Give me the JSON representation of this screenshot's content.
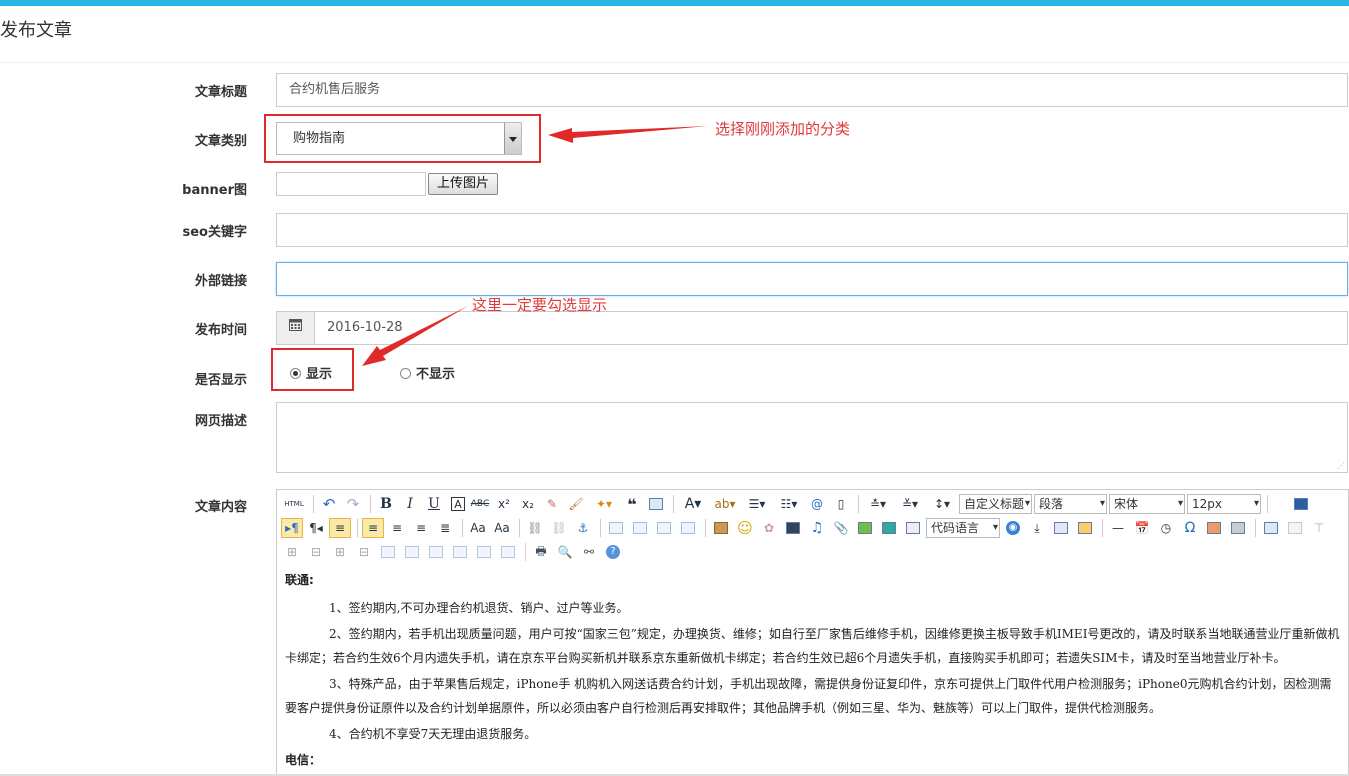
{
  "page": {
    "title": "发布文章"
  },
  "form": {
    "title_label": "文章标题",
    "title_value": "合约机售后服务",
    "category_label": "文章类别",
    "category_value": "购物指南",
    "banner_label": "banner图",
    "upload_label": "上传图片",
    "seo_label": "seo关键字",
    "seo_value": "",
    "link_label": "外部链接",
    "link_value": "",
    "time_label": "发布时间",
    "time_value": "2016-10-28",
    "show_label": "是否显示",
    "show_option": "显示",
    "hide_option": "不显示",
    "desc_label": "网页描述",
    "content_label": "文章内容"
  },
  "annotations": {
    "category_note": "选择刚刚添加的分类",
    "show_note": "这里一定要勾选显示"
  },
  "editor": {
    "toolbar": {
      "html_label": "HTML",
      "custom_title": "自定义标题",
      "paragraph": "段落",
      "font": "宋体",
      "size": "12px",
      "code_lang": "代码语言"
    },
    "content": {
      "h1": "联通:",
      "p1": "1、签约期内,不可办理合约机退货、销户、过户等业务。",
      "p2": "2、签约期内，若手机出现质量问题，用户可按“国家三包”规定，办理换货、维修；如自行至厂家售后维修手机，因维修更换主板导致手机IMEI号更改的，请及时联系当地联通营业厅重新做机卡绑定；若合约生效6个月内遗失手机，请在京东平台购买新机并联系京东重新做机卡绑定；若合约生效已超6个月遗失手机，直接购买手机即可；若遗失SIM卡，请及时至当地营业厅补卡。",
      "p3": "3、特殊产品，由于苹果售后规定，iPhone手 机购机入网送话费合约计划，手机出现故障，需提供身份证复印件，京东可提供上门取件代用户检测服务；iPhone0元购机合约计划，因检测需要客户提供身份证原件以及合约计划单据原件，所以必须由客户自行检测后再安排取件；其他品牌手机（例如三星、华为、魅族等）可以上门取件，提供代检测服务。",
      "p4": "4、合约机不享受7天无理由退货服务。",
      "h2": "电信："
    }
  }
}
